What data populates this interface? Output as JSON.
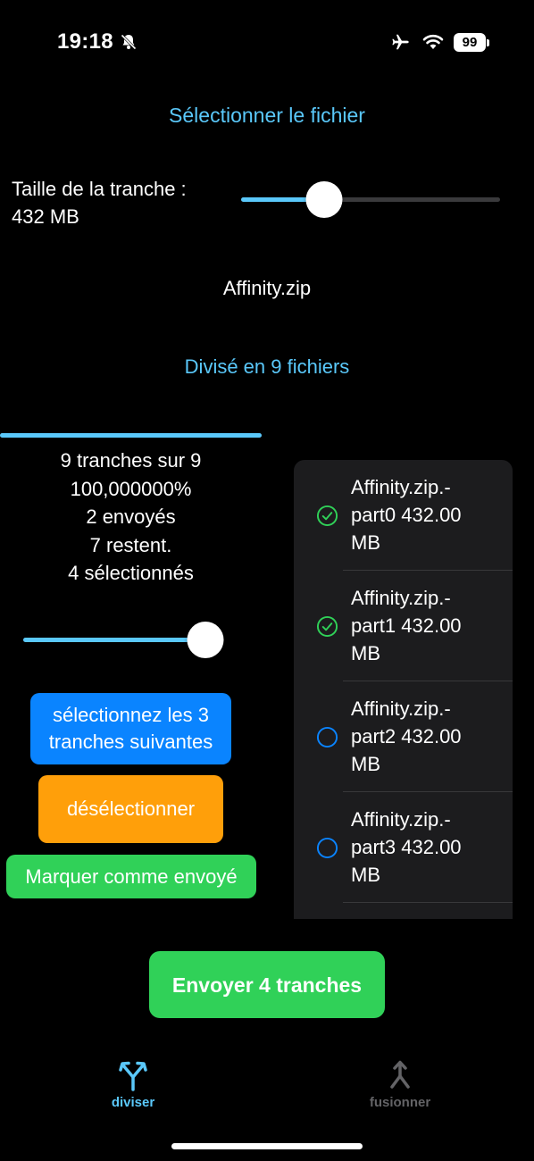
{
  "status_bar": {
    "time": "19:18",
    "battery": "99"
  },
  "file_select_label": "Sélectionner le fichier",
  "slice_size": {
    "label_line1": "Taille de la tranche :",
    "label_line2": "432 MB",
    "slider_fraction": 0.32
  },
  "filename": "Affinity.zip",
  "divided_label": "Divisé en 9 fichiers",
  "progress": {
    "fraction": 1.0
  },
  "stats": {
    "line1": "9 tranches sur 9",
    "line2": "100,000000%",
    "line3": "2 envoyés",
    "line4": "7 restent.",
    "line5": "4 sélectionnés"
  },
  "selection_slider_fraction": 1.0,
  "buttons": {
    "select_next_line1": "sélectionnez les 3",
    "select_next_line2": "tranches suivantes",
    "deselect": "désélectionner",
    "mark_sent": "Marquer comme envoyé",
    "send": "Envoyer 4 tranches"
  },
  "parts": [
    {
      "line1": "Affinity.zip.-",
      "line2": "part0 432.00",
      "line3": "MB",
      "sent": true
    },
    {
      "line1": "Affinity.zip.-",
      "line2": "part1 432.00",
      "line3": "MB",
      "sent": true
    },
    {
      "line1": "Affinity.zip.-",
      "line2": "part2 432.00",
      "line3": "MB",
      "sent": false
    },
    {
      "line1": "Affinity.zip.-",
      "line2": "part3 432.00",
      "line3": "MB",
      "sent": false
    }
  ],
  "tabs": {
    "diviser": "diviser",
    "fusionner": "fusionner"
  },
  "colors": {
    "accent": "#5ac8fa",
    "blue_button": "#0a84ff",
    "orange_button": "#ff9f0a",
    "green": "#30d158",
    "checked": "#30d158",
    "unchecked": "#0a84ff"
  }
}
